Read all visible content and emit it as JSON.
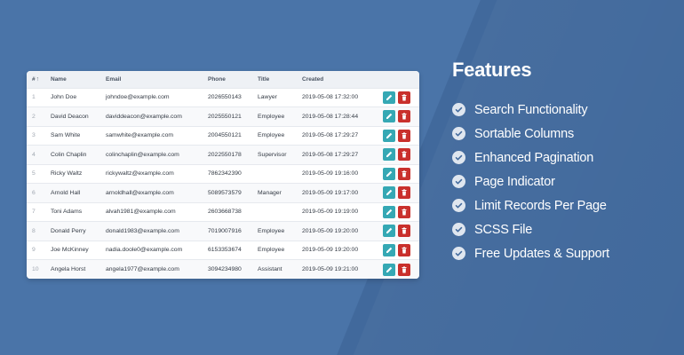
{
  "table": {
    "headers": {
      "idx": "#",
      "name": "Name",
      "email": "Email",
      "phone": "Phone",
      "title": "Title",
      "created": "Created"
    },
    "rows": [
      {
        "idx": "1",
        "name": "John Doe",
        "email": "johndoe@example.com",
        "phone": "2026550143",
        "title": "Lawyer",
        "created": "2019-05-08 17:32:00"
      },
      {
        "idx": "2",
        "name": "David Deacon",
        "email": "daviddeacon@example.com",
        "phone": "2025550121",
        "title": "Employee",
        "created": "2019-05-08 17:28:44"
      },
      {
        "idx": "3",
        "name": "Sam White",
        "email": "samwhite@example.com",
        "phone": "2004550121",
        "title": "Employee",
        "created": "2019-05-08 17:29:27"
      },
      {
        "idx": "4",
        "name": "Colin Chaplin",
        "email": "colinchaplin@example.com",
        "phone": "2022550178",
        "title": "Supervisor",
        "created": "2019-05-08 17:29:27"
      },
      {
        "idx": "5",
        "name": "Ricky Waltz",
        "email": "rickywaltz@example.com",
        "phone": "7862342390",
        "title": "",
        "created": "2019-05-09 19:16:00"
      },
      {
        "idx": "6",
        "name": "Arnold Hall",
        "email": "arnoldhall@example.com",
        "phone": "5089573579",
        "title": "Manager",
        "created": "2019-05-09 19:17:00"
      },
      {
        "idx": "7",
        "name": "Toni Adams",
        "email": "alvah1981@example.com",
        "phone": "2603668738",
        "title": "",
        "created": "2019-05-09 19:19:00"
      },
      {
        "idx": "8",
        "name": "Donald Perry",
        "email": "donald1983@example.com",
        "phone": "7019007916",
        "title": "Employee",
        "created": "2019-05-09 19:20:00"
      },
      {
        "idx": "9",
        "name": "Joe McKinney",
        "email": "nadia.doole0@example.com",
        "phone": "6153353674",
        "title": "Employee",
        "created": "2019-05-09 19:20:00"
      },
      {
        "idx": "10",
        "name": "Angela Horst",
        "email": "angela1977@example.com",
        "phone": "3094234980",
        "title": "Assistant",
        "created": "2019-05-09 19:21:00"
      }
    ],
    "row_actions": {
      "edit_icon": "pencil-icon",
      "delete_icon": "trash-icon"
    }
  },
  "features": {
    "title": "Features",
    "items": [
      "Search Functionality",
      "Sortable Columns",
      "Enhanced Pagination",
      "Page Indicator",
      "Limit Records Per Page",
      "SCSS File",
      "Free Updates & Support"
    ]
  },
  "colors": {
    "background": "#41699c",
    "edit_button": "#35a8b4",
    "delete_button": "#c9302c",
    "check_circle": "#dfe6ef"
  }
}
